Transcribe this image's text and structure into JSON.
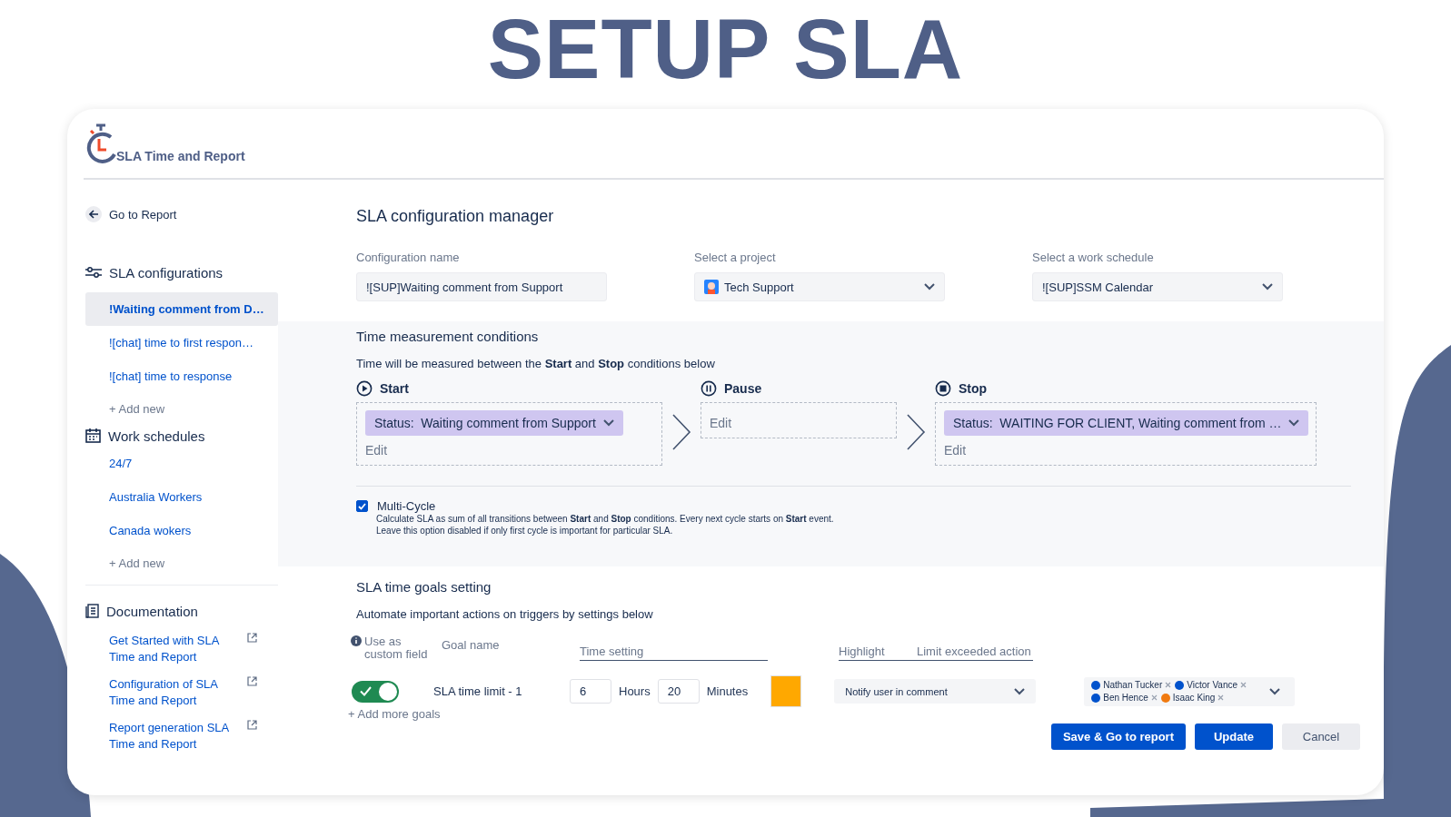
{
  "page_title": "SETUP SLA",
  "app": {
    "name": "SLA Time and Report"
  },
  "sidebar": {
    "back_link": "Go to Report",
    "sections": [
      {
        "kind": "configs",
        "title": "SLA configurations",
        "items": [
          {
            "label": "!Waiting comment from D…",
            "selected": true
          },
          {
            "label": "![chat] time to first respon…",
            "selected": false
          },
          {
            "label": "![chat] time to response",
            "selected": false
          }
        ],
        "add": "+ Add new"
      },
      {
        "kind": "schedules",
        "title": "Work schedules",
        "items": [
          {
            "label": "24/7",
            "selected": false
          },
          {
            "label": "Australia Workers",
            "selected": false
          },
          {
            "label": "Canada wokers",
            "selected": false
          }
        ],
        "add": "+ Add new"
      },
      {
        "kind": "docs",
        "title": "Documentation",
        "items": [
          {
            "label": "Get Started with SLA Time and Report",
            "selected": false
          },
          {
            "label": "Configuration of SLA Time and Report",
            "selected": false
          },
          {
            "label": "Report generation SLA Time and Report",
            "selected": false
          }
        ]
      }
    ]
  },
  "main": {
    "heading": "SLA configuration manager",
    "fields": [
      {
        "kind": "text",
        "label": "Configuration name",
        "value": "![SUP]Waiting comment from Support"
      },
      {
        "kind": "project",
        "label": "Select a project",
        "value": "Tech Support"
      },
      {
        "kind": "select",
        "label": "Select a work schedule",
        "value": "![SUP]SSM Calendar"
      }
    ],
    "conditions": {
      "title": "Time measurement conditions",
      "description": "Time will be measured between the **Start** and **Stop** conditions below",
      "steps": [
        {
          "kind": "start",
          "label": "Start",
          "chip": "Status:  Waiting comment from Support",
          "edit": "Edit"
        },
        {
          "kind": "pause",
          "label": "Pause",
          "edit": "Edit"
        },
        {
          "kind": "stop",
          "label": "Stop",
          "chip": "Status:  WAITING FOR CLIENT, Waiting comment from …",
          "edit": "Edit"
        }
      ],
      "multi_cycle": {
        "label": "Multi-Cycle",
        "checked": true,
        "lines": [
          "Calculate SLA as sum of all transitions between **Start** and **Stop** conditions. Every next cycle starts on **Start** event.",
          "Leave this option disabled if only first cycle is important for particular SLA."
        ]
      }
    },
    "goals": {
      "title": "SLA time goals setting",
      "subtitle": "Automate important actions on triggers by settings below",
      "columns": [
        "Use as custom field",
        "Goal name",
        "Time setting",
        "Highlight",
        "Limit exceeded action"
      ],
      "rows": [
        {
          "on": true,
          "name": "SLA time limit - 1",
          "hours": "6",
          "hours_unit": "Hours",
          "minutes": "20",
          "minutes_unit": "Minutes",
          "color": "#ffa800",
          "action": "Notify user in comment",
          "users": [
            {
              "name": "Nathan Tucker",
              "color": "#0052cc"
            },
            {
              "name": "Victor Vance",
              "color": "#0052cc"
            },
            {
              "name": "Ben Hence",
              "color": "#0052cc"
            },
            {
              "name": "Isaac King",
              "color": "#f07a10"
            }
          ]
        }
      ],
      "add": "+ Add more goals"
    },
    "buttons": [
      {
        "label": "Save & Go to report",
        "kind": "primary"
      },
      {
        "label": "Update",
        "kind": "primary"
      },
      {
        "label": "Cancel",
        "kind": "secondary"
      }
    ]
  }
}
